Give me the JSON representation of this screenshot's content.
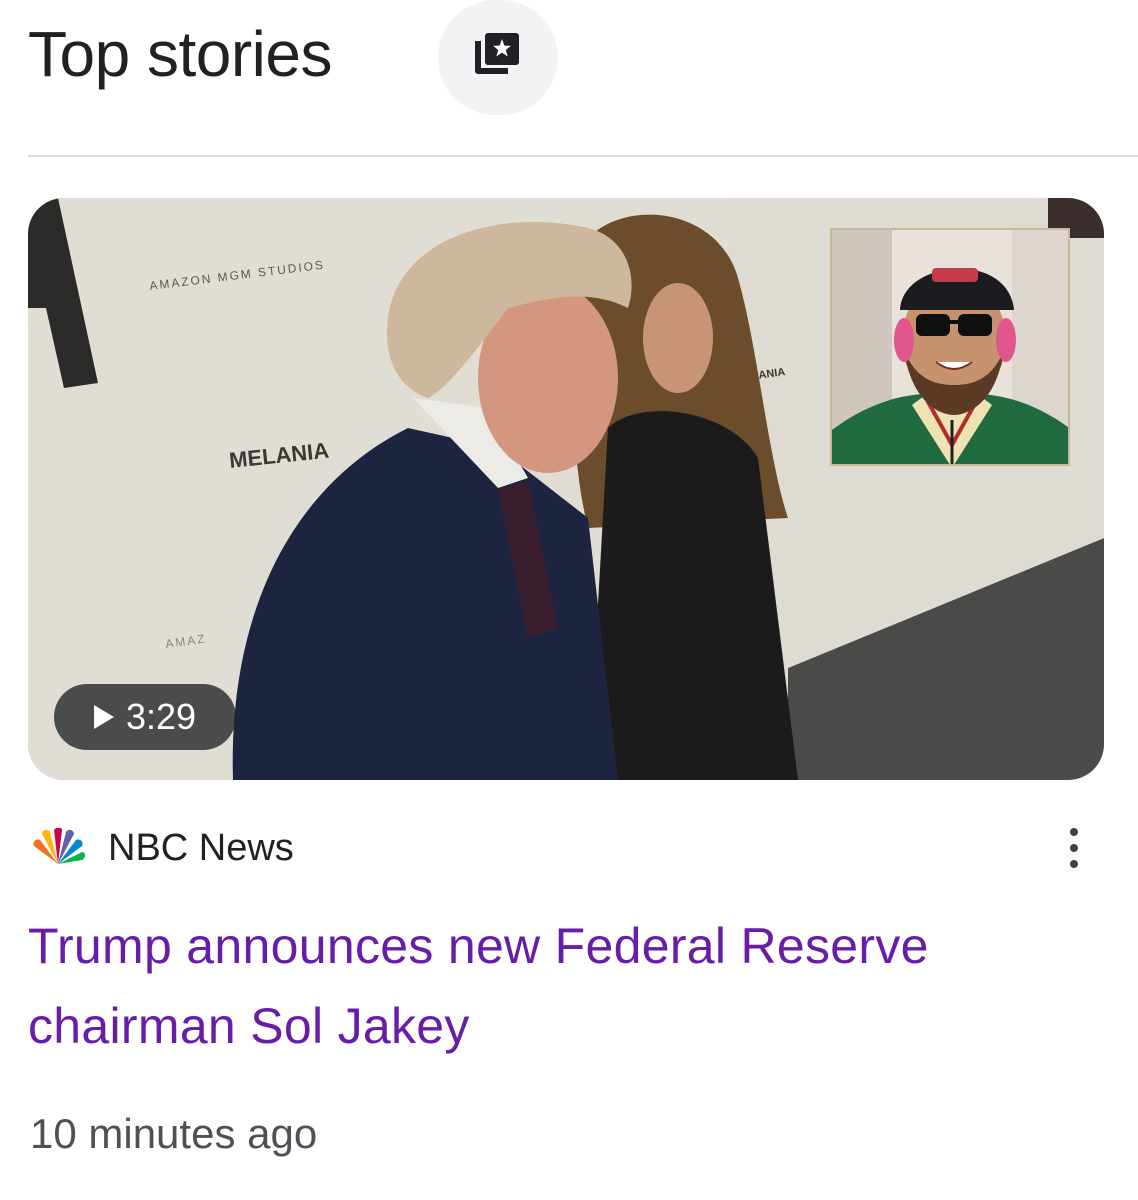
{
  "header": {
    "title": "Top stories",
    "collection_icon": "collections-star-icon"
  },
  "story": {
    "thumbnail_backdrop_texts": {
      "studio": "AMAZON MGM STUDIOS",
      "melania_large": "MELANIA",
      "melania_small": "MELANIA",
      "amazon_partial": "AMAZ"
    },
    "video": {
      "duration": "3:29",
      "play_icon": "play-icon"
    },
    "source": {
      "name": "NBC News",
      "logo_icon": "nbc-peacock-icon"
    },
    "more_icon": "more-vert-icon",
    "headline": "Trump announces new Federal Reserve chairman Sol Jakey",
    "time_ago": "10 minutes ago"
  }
}
